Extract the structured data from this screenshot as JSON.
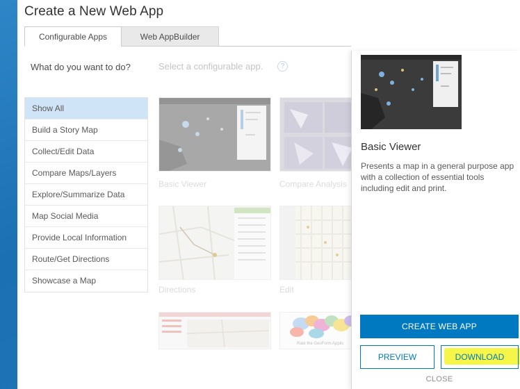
{
  "dialog": {
    "title": "Create a New Web App"
  },
  "tabs": [
    {
      "label": "Configurable Apps",
      "active": true
    },
    {
      "label": "Web AppBuilder",
      "active": false
    }
  ],
  "filters": {
    "question": "What do you want to do?",
    "items": [
      {
        "label": "Show All",
        "selected": true
      },
      {
        "label": "Build a Story Map"
      },
      {
        "label": "Collect/Edit Data"
      },
      {
        "label": "Compare Maps/Layers"
      },
      {
        "label": "Explore/Summarize Data"
      },
      {
        "label": "Map Social Media"
      },
      {
        "label": "Provide Local Information"
      },
      {
        "label": "Route/Get Directions"
      },
      {
        "label": "Showcase a Map"
      }
    ]
  },
  "gallery": {
    "prompt": "Select a configurable app.",
    "help_icon": "help-circle-icon",
    "cards": [
      {
        "name": "Basic Viewer"
      },
      {
        "name": "Compare Analysis"
      },
      {
        "name": "Directions"
      },
      {
        "name": "Edit"
      },
      {
        "name": ""
      },
      {
        "name": "",
        "thumb_caption": "Rate the GeoForm Applic"
      }
    ]
  },
  "detail": {
    "title": "Basic Viewer",
    "description": "Presents a map in a general purpose app with a collection of essential tools including edit and print.",
    "create_label": "CREATE WEB APP",
    "preview_label": "PREVIEW",
    "download_label": "DOWNLOAD",
    "close_label": "CLOSE"
  },
  "colors": {
    "accent": "#0079c1",
    "selected_filter": "#cfe4f6",
    "highlight": "#f5f53a",
    "backdrop": "#1f78b8"
  }
}
